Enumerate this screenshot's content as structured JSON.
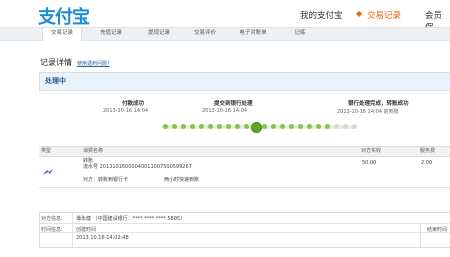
{
  "header": {
    "logo_text": "支付宝",
    "nav": [
      "我的支付宝",
      "交易记录",
      "会员保"
    ],
    "active_nav": "交易记录"
  },
  "subnav": {
    "tabs": [
      "交易记录",
      "充值记录",
      "提现记录",
      "交易评价",
      "电子对账单",
      "记练"
    ]
  },
  "page": {
    "title": "记录详情",
    "help_link": "使用遇到问题?",
    "status": "处理中"
  },
  "progress": {
    "steps": [
      {
        "title": "付款成功",
        "time": "2013-10-16 14:04"
      },
      {
        "title": "提交到银行处理",
        "time": "2013-10-16 14:04"
      },
      {
        "title": "银行处理完成，转账成功",
        "time": "2013-10-16 14:04 前到账"
      }
    ]
  },
  "table": {
    "headers": [
      "类型",
      "消费名称",
      "对方实收",
      "服务费"
    ],
    "row": {
      "name": "转账",
      "serial": "流水号 20131016000040011007500599267",
      "party": "对方：转账到银行卡",
      "note": "两小时快速到账",
      "amount": "50.00",
      "fee": "2.00"
    }
  },
  "info": {
    "party_label": "对方信息:",
    "party_value": "谭永健 （中国建设银行：**** **** **** 5805）",
    "time_label": "时间信息:",
    "created_label": "创建时间",
    "created_value": "2013.10.16 14:02:48",
    "end_label": "结束时间"
  },
  "colors": {
    "brand": "#1a8fd6",
    "accent": "#e8650b",
    "progress_green": "#86c44d"
  }
}
